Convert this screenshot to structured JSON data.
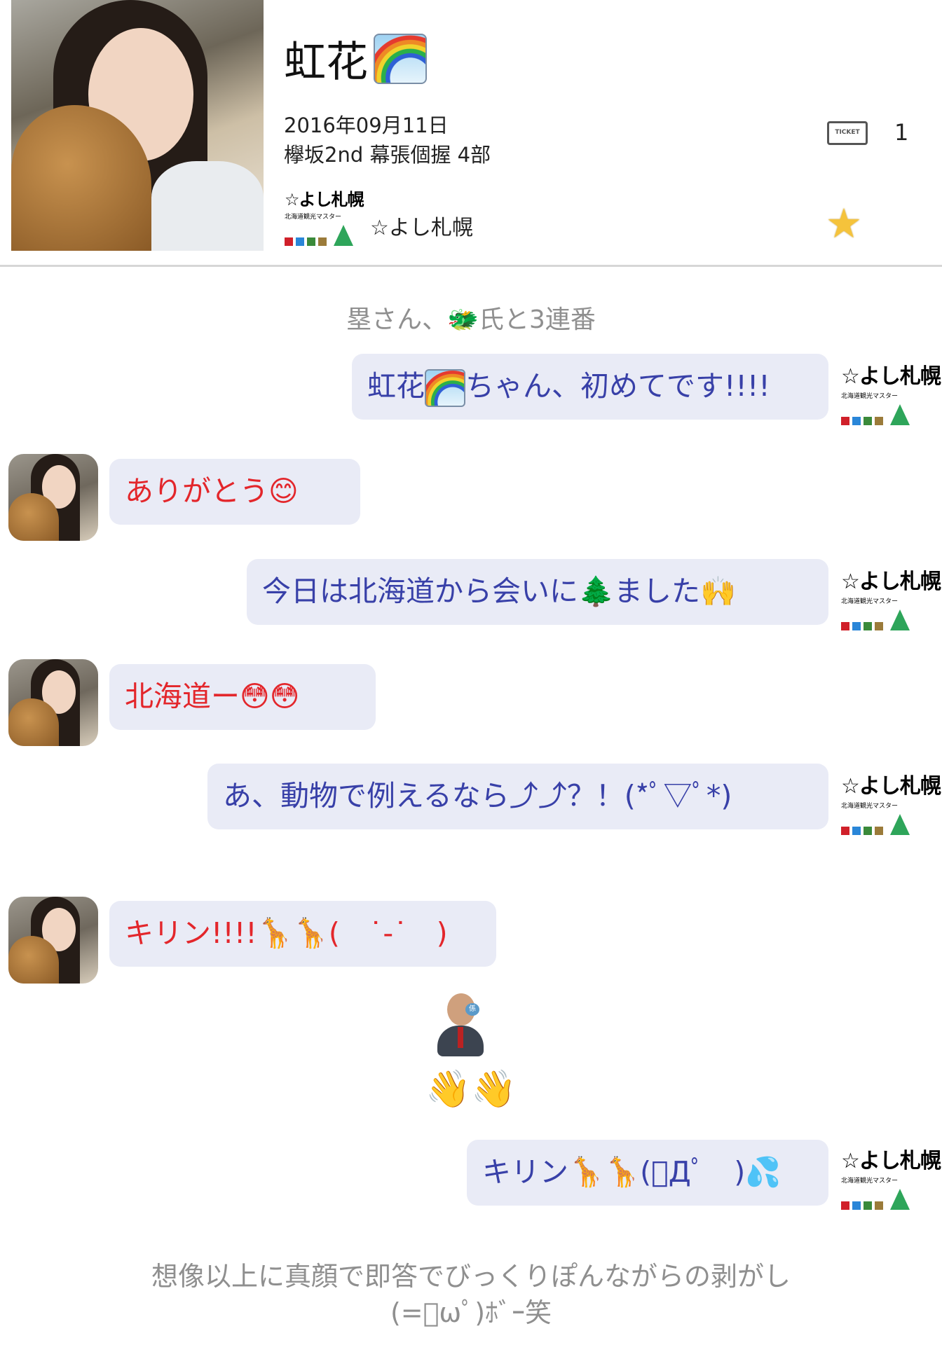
{
  "header": {
    "title": "虹花",
    "title_emoji": "rainbow-icon",
    "date": "2016年09月11日",
    "event": "欅坂2nd 幕張個握 4部",
    "fan_name": "☆よし札幌",
    "ticket_label": "TICKET",
    "ticket_count": "1",
    "star_icon": "★"
  },
  "badge": {
    "line1": "☆よし札幌",
    "line2": "北海道観光マスター"
  },
  "messages": {
    "note1": "塁さん、🐲氏と3連番",
    "m1_a": "虹花",
    "m1_b": "ちゃん、初めてです!!!!",
    "m2": "ありがとう😊",
    "m3": "今日は北海道から会いに🌲ました🙌",
    "m4": "北海道ー😳😳",
    "m5": "あ、動物で例えるなら⤴︎⤴︎？！(*ﾟ▽ﾟ*)",
    "m6": "キリン!!!!🦒🦒(　˙-˙　)",
    "waves": "👋👋",
    "m7": "キリン🦒🦒(ﾟДﾟ　)💦",
    "caption1": "想像以上に真顔で即答でびっくりぽんながらの剥がし",
    "caption2": "(=ﾟωﾟ)ﾎﾞｰ笑"
  },
  "colors": {
    "bubble_bg": "#e9ebf6",
    "outgoing_text": "#3840a8",
    "incoming_text": "#e3262b",
    "note_text": "#8f8f8f",
    "star": "#f5c33b",
    "badge_green": "#2ea55a"
  }
}
